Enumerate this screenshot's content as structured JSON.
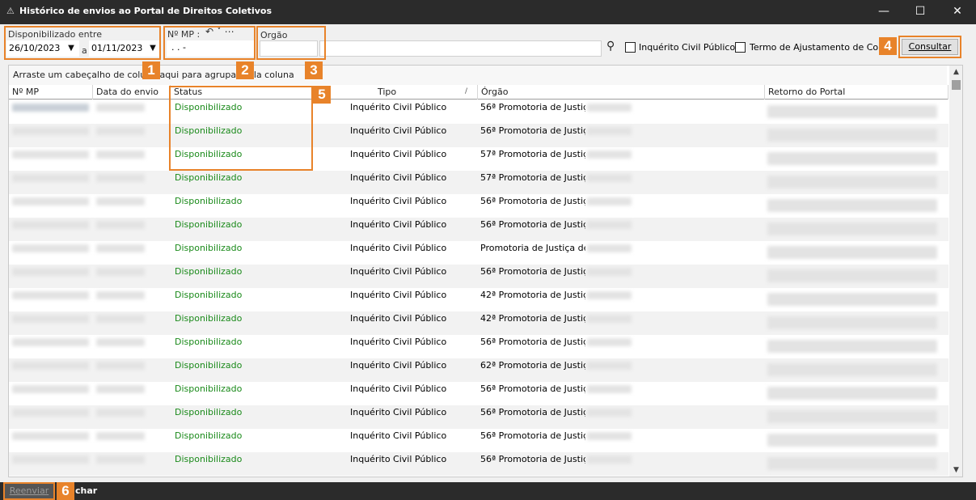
{
  "window": {
    "title": "Histórico  de envios ao Portal de Direitos Coletivos",
    "minimize_glyph": "—",
    "maximize_glyph": "☐",
    "close_glyph": "✕",
    "app_icon": "warning-triangle-icon"
  },
  "filters": {
    "period_label": "Disponibilizado entre",
    "date_from": "26/10/2023",
    "date_separator": "a",
    "date_to": "01/11/2023",
    "mp_label": "Nº MP :",
    "mp_value": ".   .       -",
    "mp_extra_glyphs": "↶ ˅  ⋯",
    "orgao_label": "Orgão",
    "orgao_value": "",
    "search_glyph": "⚲",
    "checkbox_inquerito_label": "Inquérito Civil Público",
    "checkbox_termo_label": "Termo de Ajustamento de Cond",
    "consultar_label": "Consultar"
  },
  "grid": {
    "group_hint": "Arraste um cabeçalho de coluna aqui para agrupar pela coluna",
    "columns": [
      "Nº MP",
      "Data do envio",
      "Status",
      "Tipo",
      "Órgão",
      "Retorno do Portal"
    ],
    "sort_glyph": "/",
    "rows": [
      {
        "status": "Disponibilizado",
        "tipo": "Inquérito Civil Público",
        "orgao": "56ª Promotoria de Justiça"
      },
      {
        "status": "Disponibilizado",
        "tipo": "Inquérito Civil Público",
        "orgao": "56ª Promotoria de Justiça"
      },
      {
        "status": "Disponibilizado",
        "tipo": "Inquérito Civil Público",
        "orgao": "57ª Promotoria de Justiça"
      },
      {
        "status": "Disponibilizado",
        "tipo": "Inquérito Civil Público",
        "orgao": "57ª Promotoria de Justiça"
      },
      {
        "status": "Disponibilizado",
        "tipo": "Inquérito Civil Público",
        "orgao": "56ª Promotoria de Justiça"
      },
      {
        "status": "Disponibilizado",
        "tipo": "Inquérito Civil Público",
        "orgao": "56ª Promotoria de Justiça"
      },
      {
        "status": "Disponibilizado",
        "tipo": "Inquérito Civil Público",
        "orgao": "Promotoria de Justiça de"
      },
      {
        "status": "Disponibilizado",
        "tipo": "Inquérito Civil Público",
        "orgao": "56ª Promotoria de Justiça"
      },
      {
        "status": "Disponibilizado",
        "tipo": "Inquérito Civil Público",
        "orgao": "42ª Promotoria de Justiça"
      },
      {
        "status": "Disponibilizado",
        "tipo": "Inquérito Civil Público",
        "orgao": "42ª Promotoria de Justiça"
      },
      {
        "status": "Disponibilizado",
        "tipo": "Inquérito Civil Público",
        "orgao": "56ª Promotoria de Justiça"
      },
      {
        "status": "Disponibilizado",
        "tipo": "Inquérito Civil Público",
        "orgao": "62ª Promotoria de Justiça"
      },
      {
        "status": "Disponibilizado",
        "tipo": "Inquérito Civil Público",
        "orgao": "56ª Promotoria de Justiça"
      },
      {
        "status": "Disponibilizado",
        "tipo": "Inquérito Civil Público",
        "orgao": "56ª Promotoria de Justiça"
      },
      {
        "status": "Disponibilizado",
        "tipo": "Inquérito Civil Público",
        "orgao": "56ª Promotoria de Justiça"
      },
      {
        "status": "Disponibilizado",
        "tipo": "Inquérito Civil Público",
        "orgao": "56ª Promotoria de Justiça"
      }
    ]
  },
  "footer": {
    "reenviar_label": "Reenviar",
    "fechar_label": "char"
  },
  "callouts": [
    "1",
    "2",
    "3",
    "4",
    "5",
    "6"
  ],
  "colors": {
    "accent": "#e8832a",
    "status_ok": "#1a8a1a",
    "titlebar": "#2b2b2b"
  }
}
